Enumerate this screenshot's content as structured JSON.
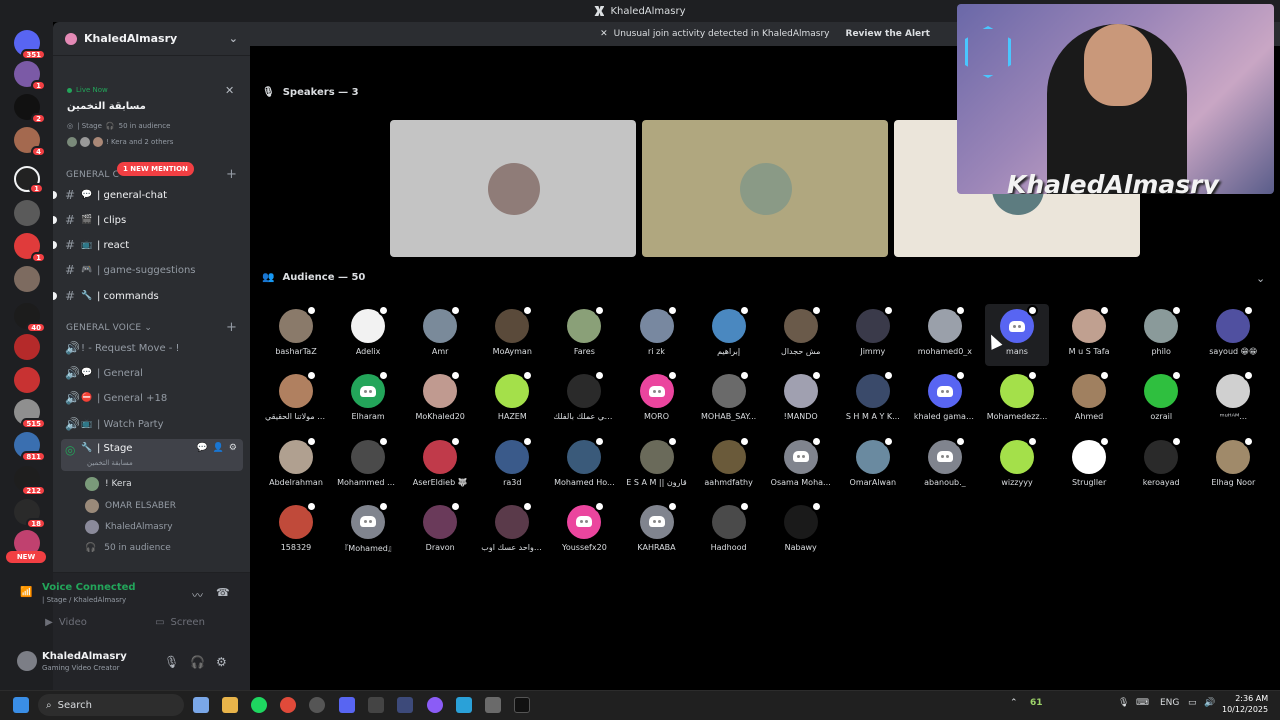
{
  "window": {
    "title": "KhaledAlmasry"
  },
  "alert": {
    "text": "Unusual join activity detected in KhaledAlmasry",
    "action": "Review the Alert"
  },
  "rail": {
    "badges": [
      "351",
      "1",
      "2",
      "4",
      "1",
      "1",
      "40",
      "515",
      "811",
      "212",
      "18"
    ],
    "new_label": "NEW"
  },
  "server": {
    "name": "KhaledAlmasry",
    "live_label": "Live Now",
    "stage_title": "مسابقة التخمين",
    "stage_info": "| Stage",
    "stage_audience": "50 in audience",
    "stage_others": "! Kera and 2 others"
  },
  "mention_pill": "1 NEW MENTION",
  "categories": {
    "general_chat": "GENERAL C",
    "general_voice": "GENERAL VOICE"
  },
  "text_channels": [
    {
      "label": "| general-chat",
      "icon": "speech-bubble-icon"
    },
    {
      "label": "| clips",
      "icon": "clapperboard-icon"
    },
    {
      "label": "| react",
      "icon": "tv-icon"
    },
    {
      "label": "| game-suggestions",
      "icon": "gamepad-icon"
    },
    {
      "label": "| commands",
      "icon": "wrench-icon"
    }
  ],
  "voice_channels": [
    {
      "label": "! - Request Move - !"
    },
    {
      "label": "| General"
    },
    {
      "label": "| General +18"
    },
    {
      "label": "| Watch Party"
    }
  ],
  "stage_channel": {
    "label": "| Stage",
    "subtitle": "مسابقة التخمين"
  },
  "stage_users": [
    {
      "name": "! Kera"
    },
    {
      "name": "OMAR ELSABER"
    },
    {
      "name": "KhaledAlmasry"
    }
  ],
  "stage_audience_label": "50 in audience",
  "voice_panel": {
    "status": "Voice Connected",
    "location": "| Stage / KhaledAlmasry",
    "video": "Video",
    "screen": "Screen"
  },
  "user": {
    "name": "KhaledAlmasry",
    "status": "Gaming Video Creator"
  },
  "speakers": {
    "heading": "Speakers — 3",
    "tiles": [
      "#c4c4c4",
      "#b0a77f",
      "#ebe5da"
    ]
  },
  "audience": {
    "heading": "Audience — 50",
    "members": [
      "basharTaZ",
      "Adelix",
      "Amr",
      "MoAyman",
      "Fares",
      "ri zk",
      "إبراهيم",
      "مش حجدال",
      "Jimmy",
      "mohamed0_x",
      "mans",
      "M u S Tafa",
      "philo",
      "sayoud 😁😁",
      "أبي مولاتنا الحقيقي",
      "Elharam",
      "MoKhaled20",
      "HAZEM",
      "ميسي عملك بالفلك",
      "MORO",
      "MOHAB_SAY...",
      "!MANDO",
      "S H M A Y K...",
      "khaled gamal ...",
      "Mohamedezz...",
      "Ahmed",
      "ozrail",
      "ᵐᵘᴴᴬᴹ...",
      "Abdelrahman",
      "Mohammed o...",
      "AserEldieb 🐺",
      "ra3d",
      "Mohamed Ho...",
      "E S A M || قارون",
      "aahmdfathy",
      "Osama Moha...",
      "OmarAlwan",
      "abanoub._",
      "wizzyyy",
      "Strugller",
      "keroayad",
      "Elhag Noor",
      "158329",
      "『Mohamed』",
      "Dravon",
      "ين واحد عسك اوب",
      "Youssefx20",
      "KAHRABA",
      "Hadhood",
      "Nabawy"
    ]
  },
  "webcam": {
    "overlay_name": "KhaledAlmasry"
  },
  "taskbar": {
    "search": "Search",
    "lang": "ENG",
    "temp": "61",
    "time": "2:36 AM",
    "date": "10/12/2025"
  }
}
